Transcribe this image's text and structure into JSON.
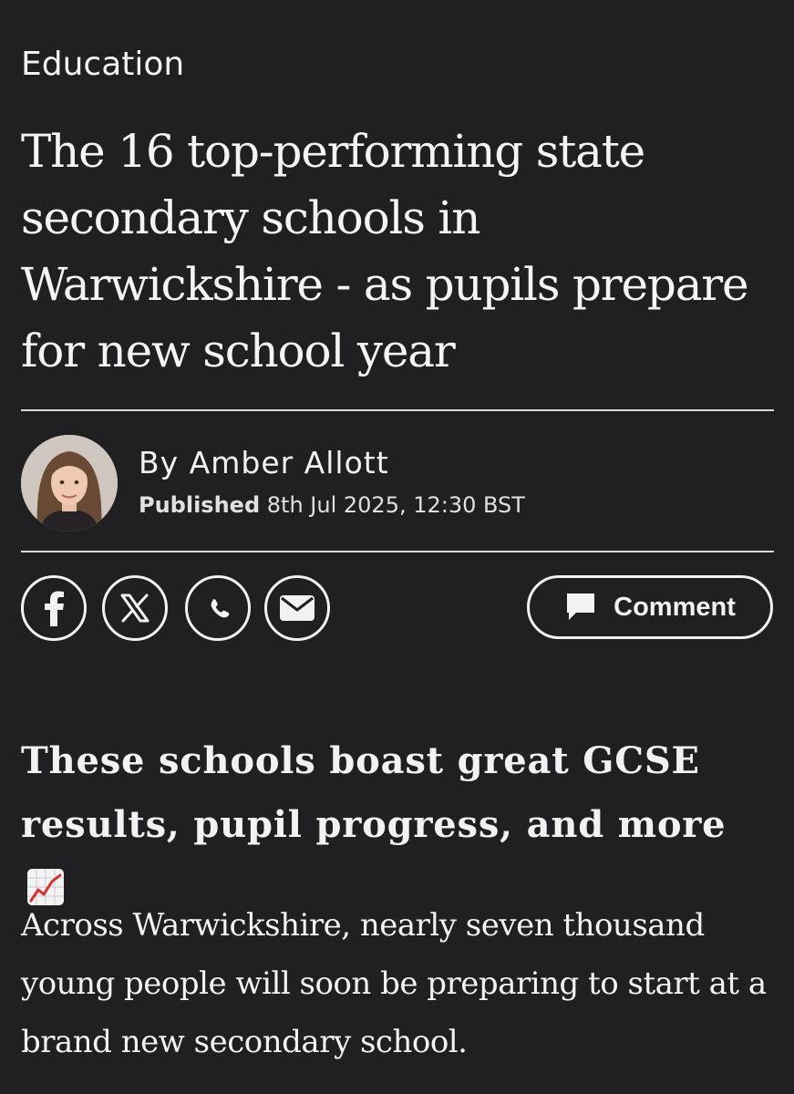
{
  "article": {
    "category": "Education",
    "headline": "The 16 top-performing state secondary schools in Warwickshire - as pupils prepare for new school year",
    "author_byline": "By Amber Allott",
    "published_label": "Published",
    "published_date": "8th Jul 2025, 12:30 BST",
    "standfirst": "These schools boast great GCSE results, pupil progress, and more",
    "standfirst_emoji": "chart-increasing-icon",
    "body_first_paragraph": "Across Warwickshire, nearly seven thousand young people will soon be preparing to start at a brand new secondary school."
  },
  "share": {
    "icons": [
      "facebook-icon",
      "x-icon",
      "whatsapp-icon",
      "email-icon"
    ],
    "comment_label": "Comment"
  },
  "colors": {
    "background": "#202022",
    "text": "#f2f2f2",
    "divider": "#d9d9d9"
  }
}
